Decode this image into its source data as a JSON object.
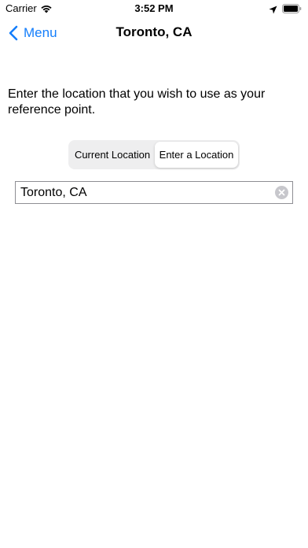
{
  "status_bar": {
    "carrier": "Carrier",
    "time": "3:52 PM",
    "icons": [
      "wifi-icon",
      "location-arrow-icon",
      "battery-icon"
    ]
  },
  "nav": {
    "back_label": "Menu",
    "title": "Toronto, CA",
    "accent_color": "#147EFB"
  },
  "main": {
    "instruction": "Enter the location that you wish to use as your reference point.",
    "segments": [
      {
        "label": "Current Location",
        "selected": false
      },
      {
        "label": "Enter a Location",
        "selected": true
      }
    ],
    "search": {
      "value": "Toronto, CA",
      "placeholder": ""
    }
  }
}
